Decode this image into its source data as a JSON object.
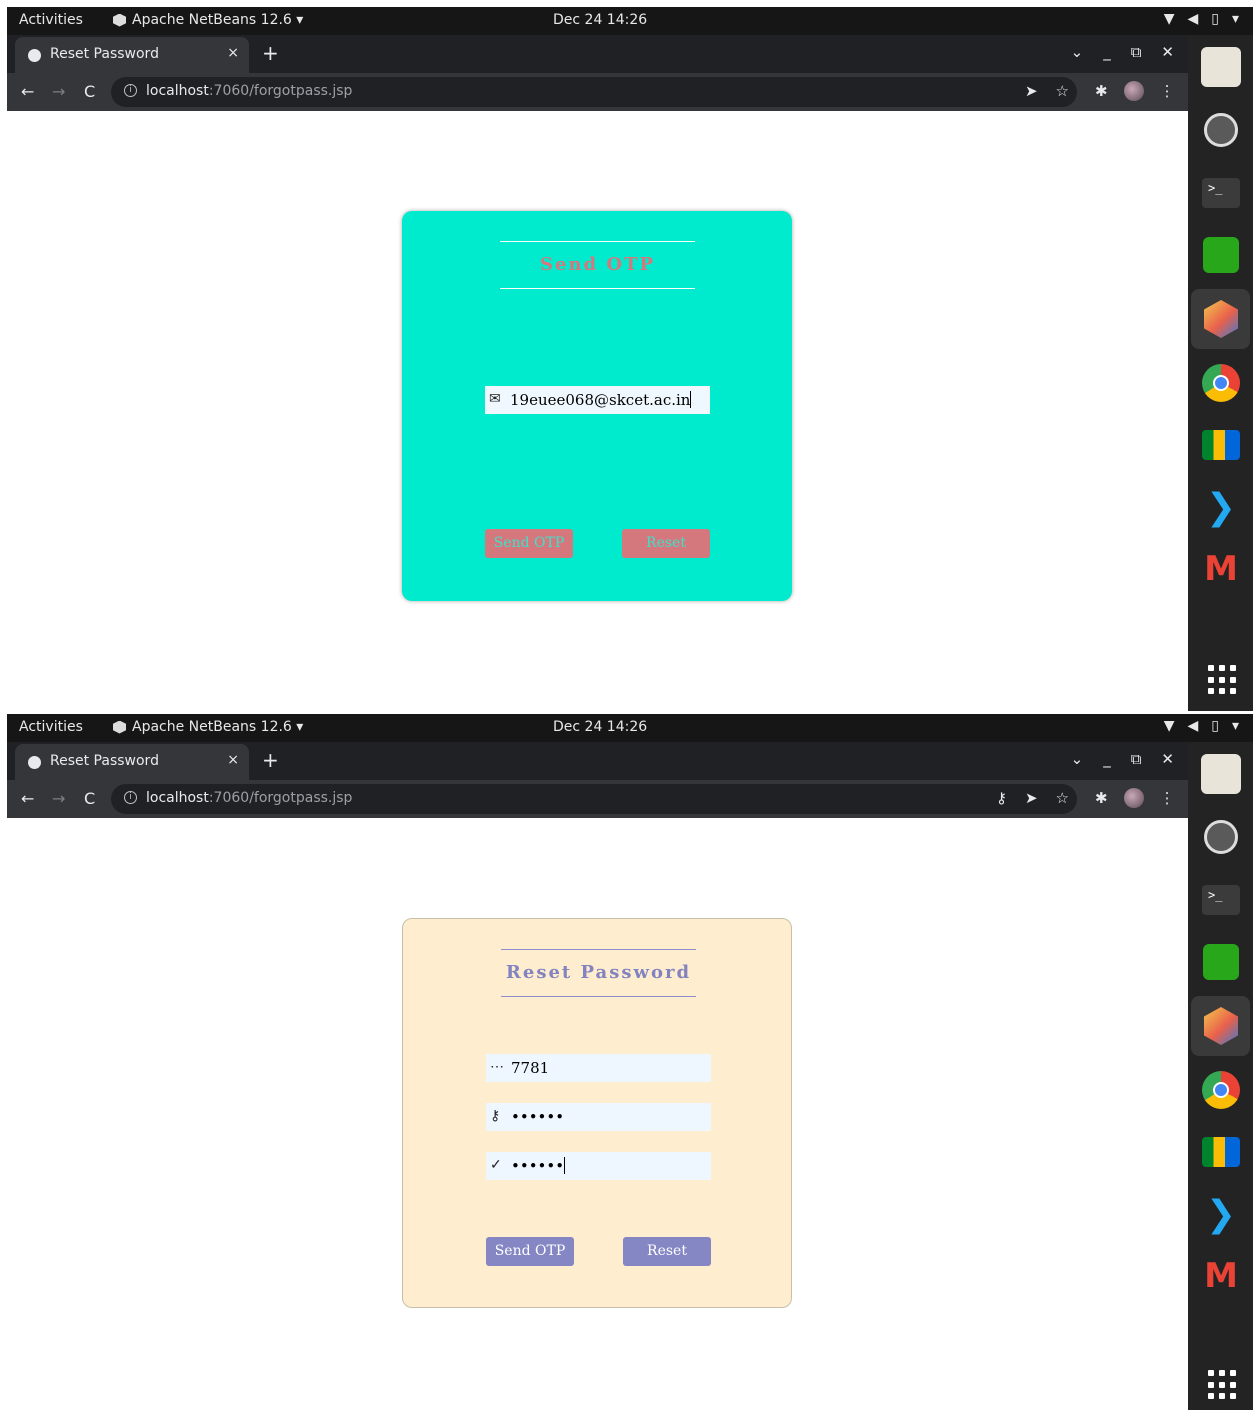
{
  "topbar": {
    "activities": "Activities",
    "app_name": "Apache NetBeans 12.6 ▾",
    "clock": "Dec 24  14:26",
    "tray_icons": [
      "wifi-icon",
      "volume-icon",
      "battery-icon",
      "system-menu-chevron-icon"
    ]
  },
  "browser": {
    "tab_title": "Reset Password",
    "tab_close": "×",
    "new_tab": "+",
    "url_host": "localhost",
    "url_rest": ":7060/forgotpass.jsp",
    "window_controls": [
      "⌄",
      "_",
      "⧉",
      "✕"
    ],
    "nav": {
      "back": "←",
      "forward": "→",
      "reload": "C"
    }
  },
  "dock": {
    "items": [
      "files-icon",
      "settings-icon",
      "terminal-icon",
      "whatsapp-icon",
      "netbeans-icon",
      "chrome-icon",
      "google-meet-icon",
      "vscode-icon",
      "gmail-icon",
      "show-apps-icon"
    ]
  },
  "screen1": {
    "card_title": "Send OTP",
    "email_value": "19euee068@skcet.ac.in",
    "send_otp_label": "Send OTP",
    "reset_label": "Reset",
    "card_color": "#00ebcd",
    "button_color": "#d4787e"
  },
  "screen2": {
    "card_title": "Reset Password",
    "otp_value": "7781",
    "password_value": "••••••",
    "confirm_value": "••••••",
    "send_otp_label": "Send OTP",
    "reset_label": "Reset",
    "card_color": "#feeecf",
    "button_color": "#8586c4"
  }
}
